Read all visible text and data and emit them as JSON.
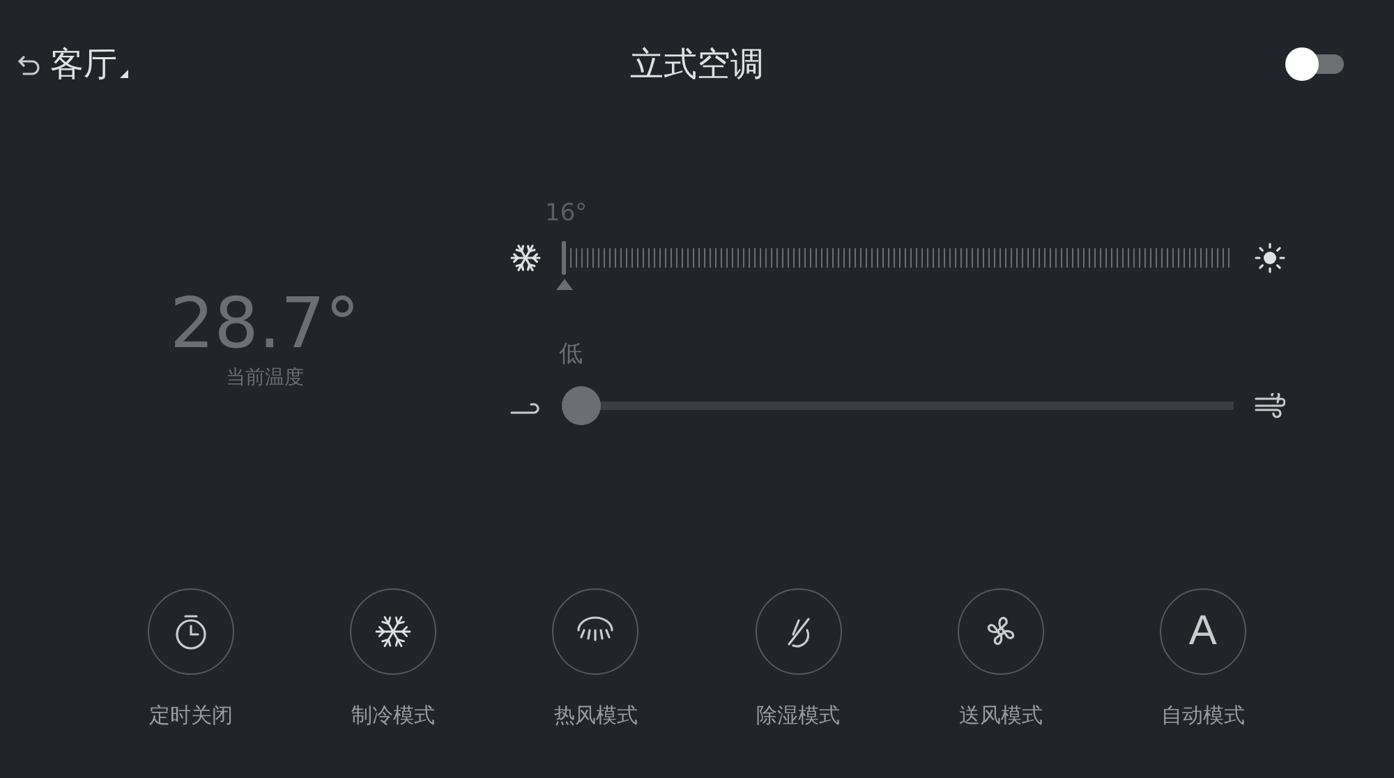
{
  "header": {
    "back_label": "客厅",
    "title": "立式空调",
    "power": {
      "on": false
    }
  },
  "current": {
    "temperature": "28.7°",
    "label": "当前温度"
  },
  "temperature_slider": {
    "reading": "16°",
    "level": 0
  },
  "wind_slider": {
    "reading": "低",
    "level": 0
  },
  "modes": [
    {
      "kind": "timer",
      "label": "定时关闭"
    },
    {
      "kind": "cool",
      "label": "制冷模式"
    },
    {
      "kind": "heat",
      "label": "热风模式"
    },
    {
      "kind": "dry",
      "label": "除湿模式"
    },
    {
      "kind": "fan",
      "label": "送风模式"
    },
    {
      "kind": "auto",
      "glyph": "A",
      "label": "自动模式"
    }
  ]
}
